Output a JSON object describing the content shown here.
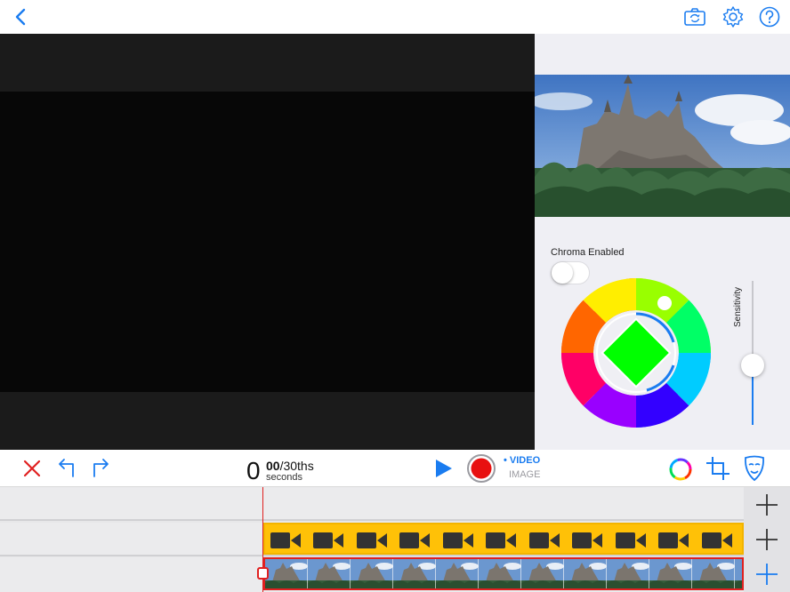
{
  "topbar": {
    "back_icon": "chevron-left-icon",
    "right_icons": [
      "camera-switch-icon",
      "gear-icon",
      "help-icon"
    ]
  },
  "chroma": {
    "label": "Chroma Enabled",
    "enabled": false,
    "key_color": "#00ff00",
    "sensitivity_label": "Sensitivity",
    "sensitivity_level": 0.42
  },
  "toolbar": {
    "icons": [
      "close-icon",
      "undo-icon",
      "redo-icon",
      "play-icon",
      "record-icon",
      "color-wheel-icon",
      "crop-icon",
      "mask-icon"
    ],
    "time_seconds": "0",
    "time_frames": "00",
    "time_frame_unit": "/30ths",
    "time_unit_label": "seconds",
    "mode_video": "• VIDEO",
    "mode_image": "IMAGE"
  },
  "timeline": {
    "tracks": [
      "empty",
      "video",
      "image"
    ],
    "video_clip_icon": "video-camera-icon",
    "image_clip": "castle-thumbnail",
    "add_track_icon": "plus-icon"
  },
  "colors": {
    "accent": "#1a7cf0",
    "record": "#e02020",
    "clip_video": "#ffc107",
    "panel_bg": "#efeff4"
  }
}
